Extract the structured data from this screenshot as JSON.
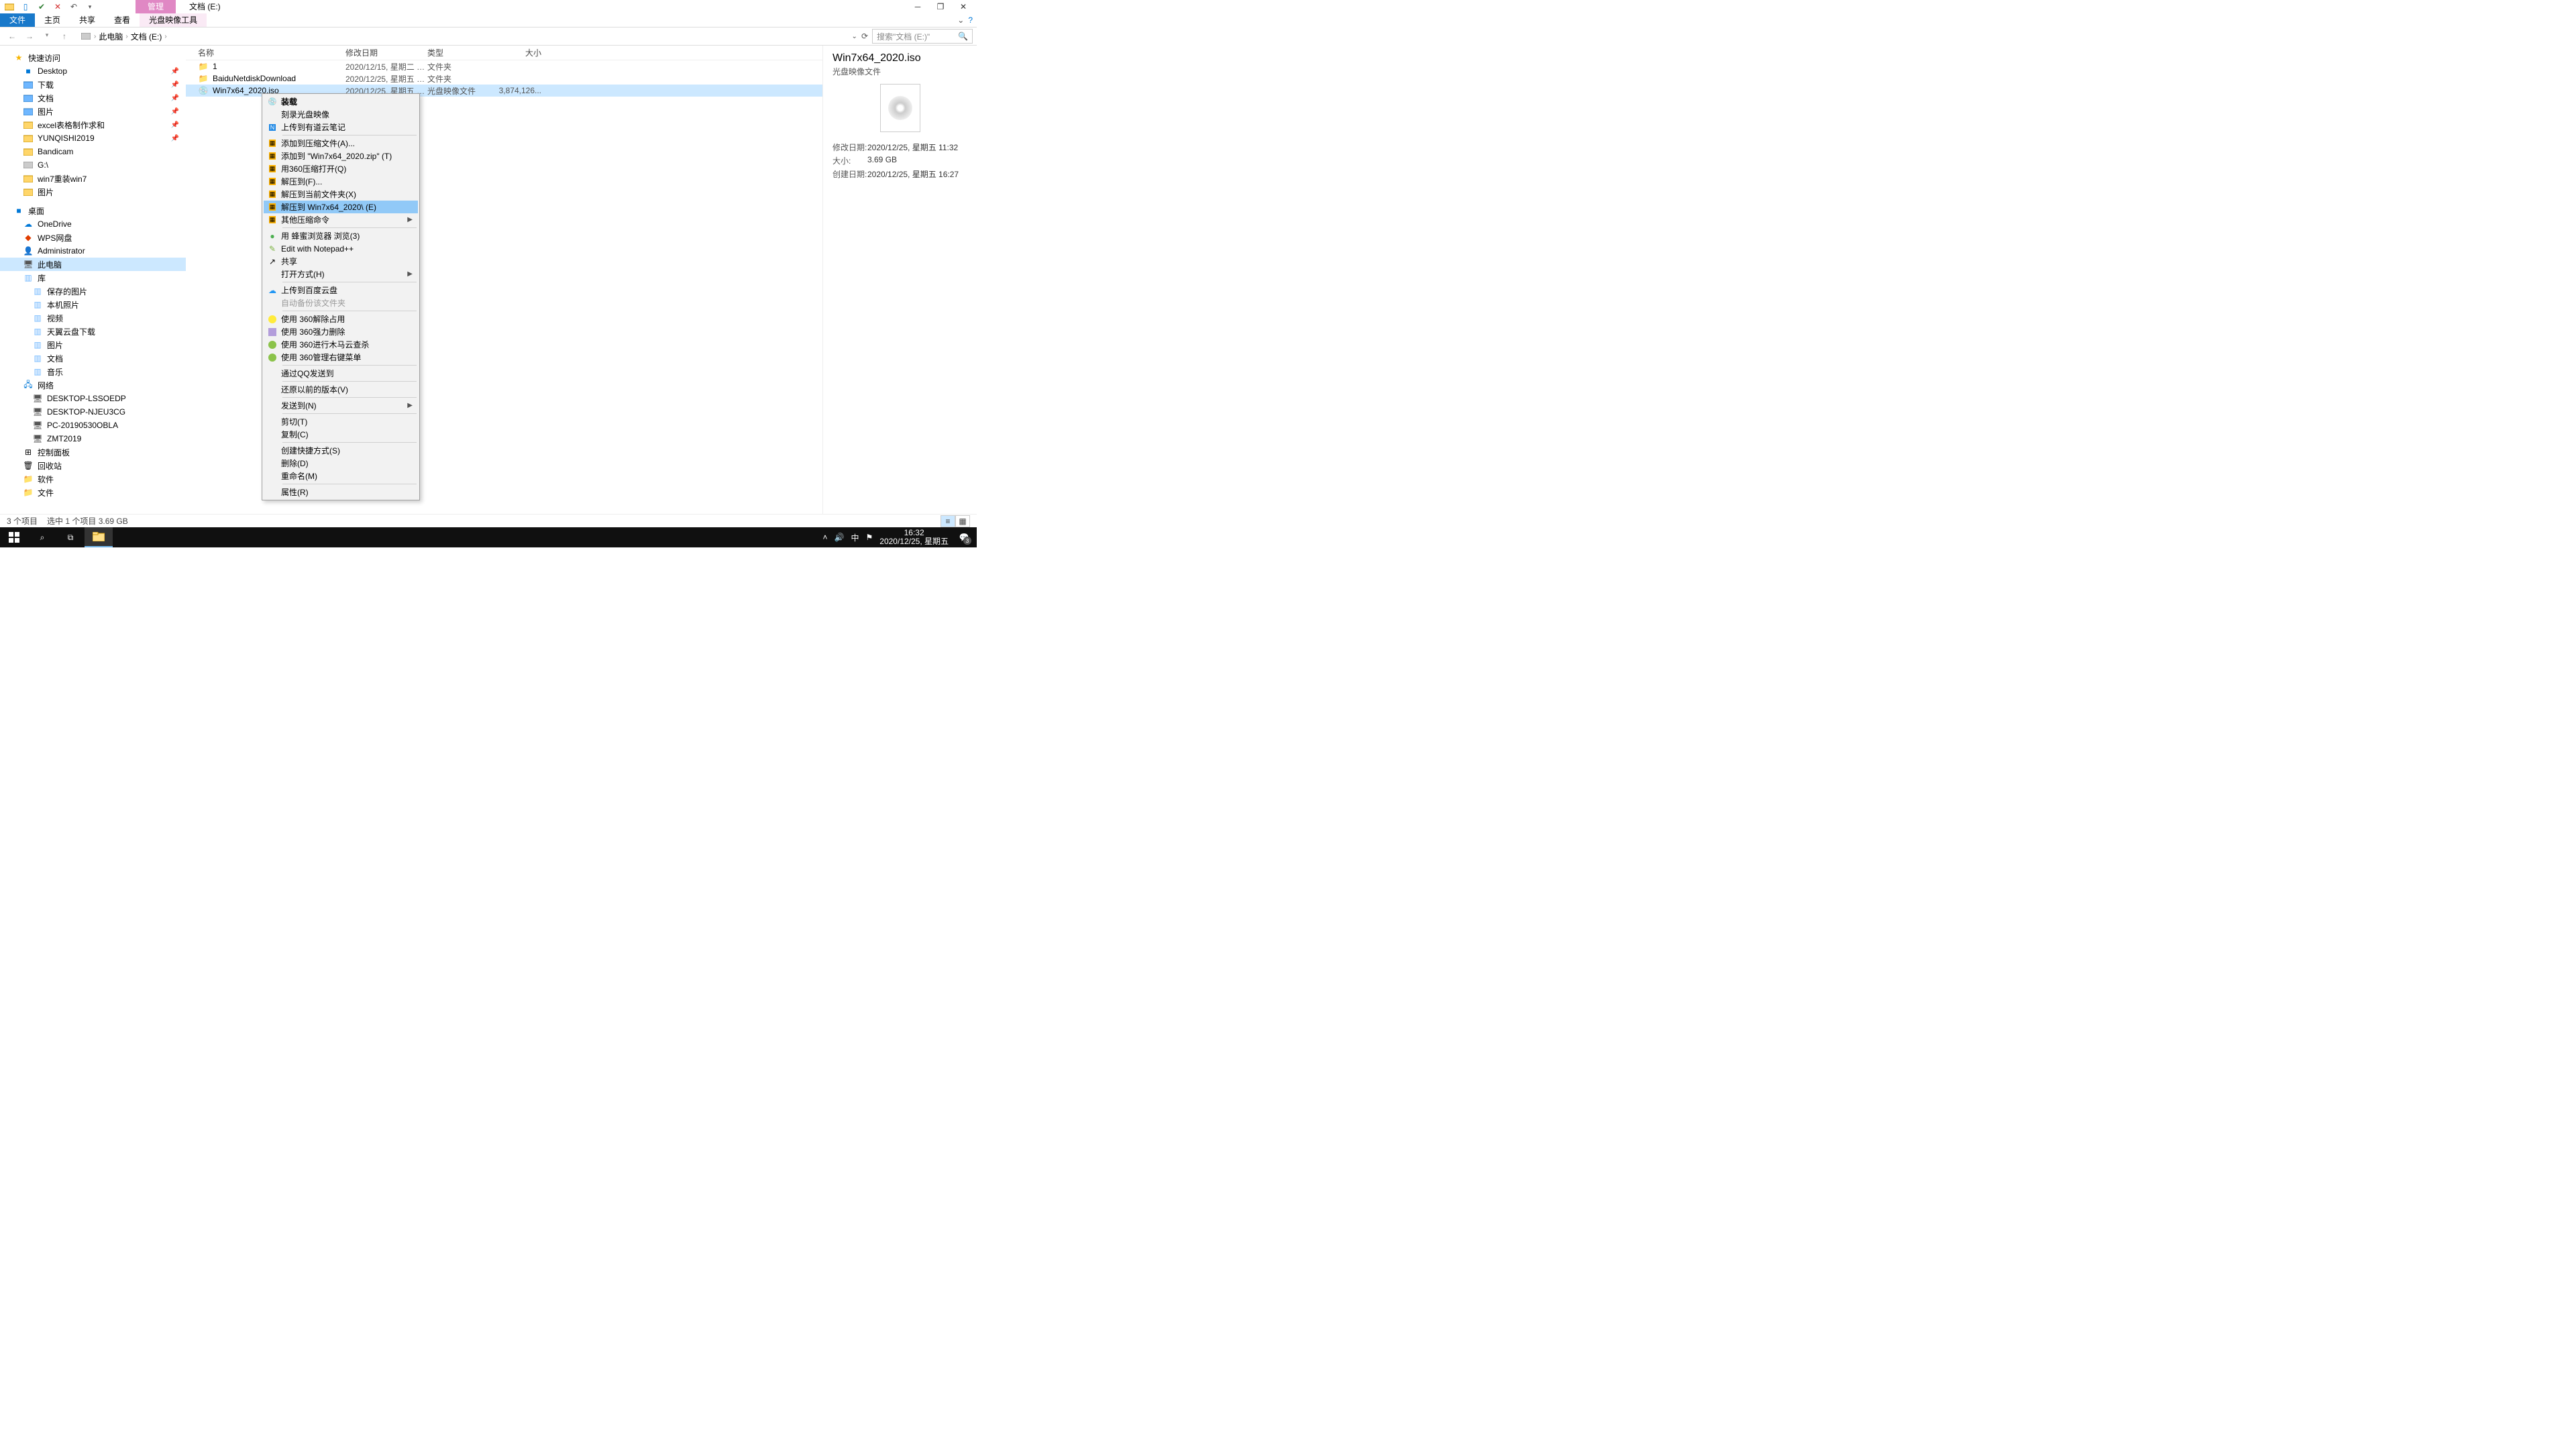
{
  "window": {
    "contextual_tab": "管理",
    "title": "文档 (E:)",
    "ribbon_tabs": [
      "文件",
      "主页",
      "共享",
      "查看",
      "光盘映像工具"
    ],
    "active_ribbon": 0
  },
  "breadcrumb": [
    "此电脑",
    "文档 (E:)"
  ],
  "search_placeholder": "搜索\"文档 (E:)\"",
  "columns": {
    "name": "名称",
    "date": "修改日期",
    "type": "类型",
    "size": "大小"
  },
  "nav": {
    "quick": {
      "label": "快速访问",
      "items": [
        {
          "label": "Desktop",
          "pin": true,
          "icon": "desktop"
        },
        {
          "label": "下载",
          "pin": true,
          "icon": "folder-blue"
        },
        {
          "label": "文档",
          "pin": true,
          "icon": "folder-blue"
        },
        {
          "label": "图片",
          "pin": true,
          "icon": "folder-blue"
        },
        {
          "label": "excel表格制作求和",
          "pin": true,
          "icon": "folder"
        },
        {
          "label": "YUNQISHI2019",
          "pin": true,
          "icon": "folder"
        },
        {
          "label": "Bandicam",
          "pin": false,
          "icon": "folder"
        },
        {
          "label": "G:\\",
          "pin": false,
          "icon": "drive"
        },
        {
          "label": "win7重装win7",
          "pin": false,
          "icon": "folder"
        },
        {
          "label": "图片",
          "pin": false,
          "icon": "folder"
        }
      ]
    },
    "desktop": {
      "label": "桌面",
      "items": [
        {
          "label": "OneDrive",
          "icon": "cloud"
        },
        {
          "label": "WPS网盘",
          "icon": "wps"
        },
        {
          "label": "Administrator",
          "icon": "user"
        },
        {
          "label": "此电脑",
          "icon": "pc",
          "selected": true
        },
        {
          "label": "库",
          "icon": "library"
        }
      ]
    },
    "library_items": [
      "保存的图片",
      "本机照片",
      "视频",
      "天翼云盘下载",
      "图片",
      "文档",
      "音乐"
    ],
    "network": {
      "label": "网络",
      "items": [
        "DESKTOP-LSSOEDP",
        "DESKTOP-NJEU3CG",
        "PC-20190530OBLA",
        "ZMT2019"
      ]
    },
    "others": [
      "控制面板",
      "回收站",
      "软件",
      "文件"
    ]
  },
  "files": [
    {
      "name": "1",
      "date": "2020/12/15, 星期二 1...",
      "type": "文件夹",
      "size": "",
      "icon": "folder"
    },
    {
      "name": "BaiduNetdiskDownload",
      "date": "2020/12/25, 星期五 1...",
      "type": "文件夹",
      "size": "",
      "icon": "folder"
    },
    {
      "name": "Win7x64_2020.iso",
      "date": "2020/12/25, 星期五 1...",
      "type": "光盘映像文件",
      "size": "3,874,126...",
      "icon": "iso",
      "selected": true
    }
  ],
  "context_menu": [
    {
      "label": "装载",
      "icon": "disc",
      "bold": true
    },
    {
      "label": "刻录光盘映像"
    },
    {
      "label": "上传到有道云笔记",
      "icon": "note-blue"
    },
    {
      "sep": true
    },
    {
      "label": "添加到压缩文件(A)...",
      "icon": "zip"
    },
    {
      "label": "添加到 \"Win7x64_2020.zip\" (T)",
      "icon": "zip"
    },
    {
      "label": "用360压缩打开(Q)",
      "icon": "zip"
    },
    {
      "label": "解压到(F)...",
      "icon": "zip"
    },
    {
      "label": "解压到当前文件夹(X)",
      "icon": "zip"
    },
    {
      "label": "解压到 Win7x64_2020\\ (E)",
      "icon": "zip",
      "hover": true
    },
    {
      "label": "其他压缩命令",
      "icon": "zip",
      "submenu": true
    },
    {
      "sep": true
    },
    {
      "label": "用 蜂蜜浏览器 浏览(3)",
      "icon": "green"
    },
    {
      "label": "Edit with Notepad++",
      "icon": "npp"
    },
    {
      "label": "共享",
      "icon": "share"
    },
    {
      "label": "打开方式(H)",
      "submenu": true
    },
    {
      "sep": true
    },
    {
      "label": "上传到百度云盘",
      "icon": "baidu"
    },
    {
      "label": "自动备份该文件夹",
      "disabled": true
    },
    {
      "sep": true
    },
    {
      "label": "使用 360解除占用",
      "icon": "360y"
    },
    {
      "label": "使用 360强力删除",
      "icon": "360d"
    },
    {
      "label": "使用 360进行木马云查杀",
      "icon": "360g"
    },
    {
      "label": "使用 360管理右键菜单",
      "icon": "360g"
    },
    {
      "sep": true
    },
    {
      "label": "通过QQ发送到"
    },
    {
      "sep": true
    },
    {
      "label": "还原以前的版本(V)"
    },
    {
      "sep": true
    },
    {
      "label": "发送到(N)",
      "submenu": true
    },
    {
      "sep": true
    },
    {
      "label": "剪切(T)"
    },
    {
      "label": "复制(C)"
    },
    {
      "sep": true
    },
    {
      "label": "创建快捷方式(S)"
    },
    {
      "label": "删除(D)"
    },
    {
      "label": "重命名(M)"
    },
    {
      "sep": true
    },
    {
      "label": "属性(R)"
    }
  ],
  "preview": {
    "title": "Win7x64_2020.iso",
    "subtitle": "光盘映像文件",
    "props": [
      {
        "label": "修改日期:",
        "value": "2020/12/25, 星期五 11:32"
      },
      {
        "label": "大小:",
        "value": "3.69 GB"
      },
      {
        "label": "创建日期:",
        "value": "2020/12/25, 星期五 16:27"
      }
    ]
  },
  "status": {
    "count": "3 个项目",
    "selection": "选中 1 个项目  3.69 GB"
  },
  "taskbar": {
    "time": "16:32",
    "date": "2020/12/25, 星期五",
    "badge": "3",
    "ime": "中"
  }
}
